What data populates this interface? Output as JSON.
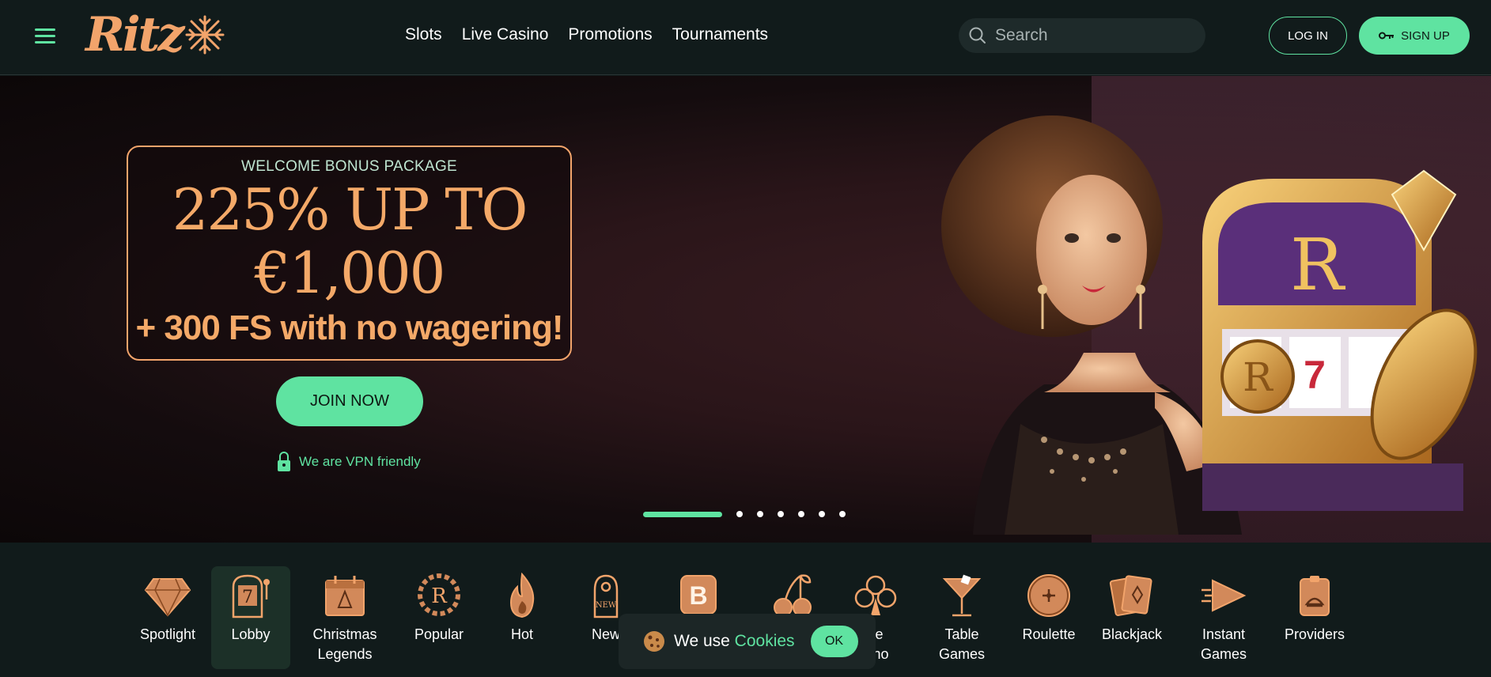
{
  "header": {
    "logo_text": "Ritz",
    "nav": [
      "Slots",
      "Live Casino",
      "Promotions",
      "Tournaments"
    ],
    "search_placeholder": "Search",
    "login_label": "LOG IN",
    "signup_label": "SIGN UP"
  },
  "hero": {
    "kicker": "WELCOME BONUS PACKAGE",
    "main_line1": "225% UP TO",
    "main_line2": "€1,000",
    "sub": "+ 300 FS with no wagering!",
    "join_label": "JOIN NOW",
    "vpn_text": "We are VPN friendly",
    "slide_count": 7,
    "active_slide": 1
  },
  "categories": [
    {
      "label": "Spotlight",
      "icon": "diamond-icon"
    },
    {
      "label": "Lobby",
      "icon": "slot-machine-icon"
    },
    {
      "label": "Christmas Legends",
      "icon": "calendar-tree-icon"
    },
    {
      "label": "Popular",
      "icon": "laurel-r-icon"
    },
    {
      "label": "Hot",
      "icon": "flame-icon"
    },
    {
      "label": "New",
      "icon": "door-hanger-icon"
    },
    {
      "label": "",
      "icon": "b-badge-icon"
    },
    {
      "label": "",
      "icon": "cherries-icon"
    },
    {
      "label": "ve\nsino",
      "icon": "club-icon"
    },
    {
      "label": "Table Games",
      "icon": "cocktail-icon"
    },
    {
      "label": "Roulette",
      "icon": "roulette-icon"
    },
    {
      "label": "Blackjack",
      "icon": "cards-icon"
    },
    {
      "label": "Instant Games",
      "icon": "arrow-icon"
    },
    {
      "label": "Providers",
      "icon": "provider-icon"
    }
  ],
  "cookie": {
    "prefix": "We use",
    "link": "Cookies",
    "ok_label": "OK"
  },
  "colors": {
    "accent": "#5fe3a1",
    "gold": "#f2a46b",
    "bg": "#111b1b"
  }
}
